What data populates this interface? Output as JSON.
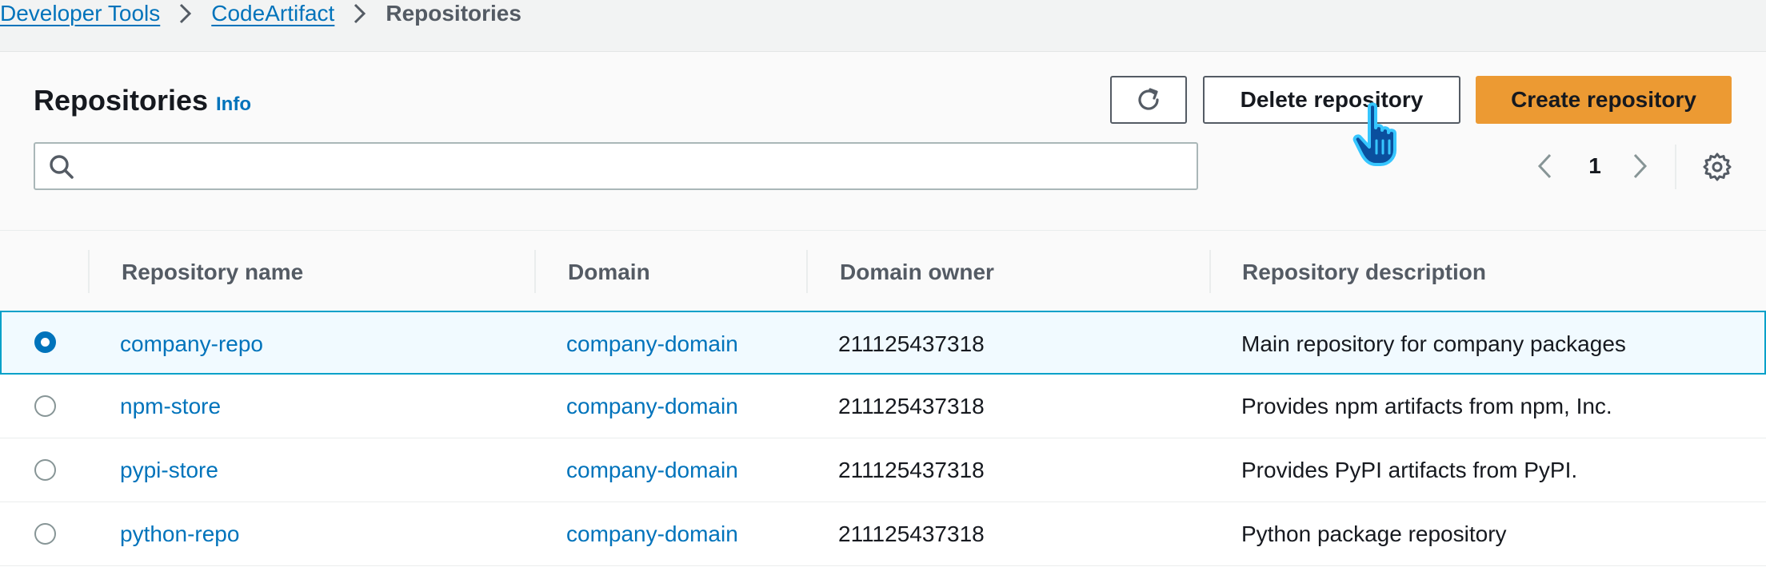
{
  "breadcrumb": {
    "items": [
      "Developer Tools",
      "CodeArtifact"
    ],
    "current": "Repositories"
  },
  "header": {
    "title": "Repositories",
    "info_label": "Info"
  },
  "toolbar": {
    "refresh_icon": "refresh-icon",
    "delete_label": "Delete repository",
    "create_label": "Create repository",
    "create_color": "#ec9a33"
  },
  "search": {
    "placeholder": "",
    "value": ""
  },
  "pagination": {
    "current_page": "1"
  },
  "table": {
    "columns": [
      "Repository name",
      "Domain",
      "Domain owner",
      "Repository description"
    ],
    "rows": [
      {
        "name": "company-repo",
        "domain": "company-domain",
        "owner": "211125437318",
        "description": "Main repository for company packages",
        "selected": true
      },
      {
        "name": "npm-store",
        "domain": "company-domain",
        "owner": "211125437318",
        "description": "Provides npm artifacts from npm, Inc.",
        "selected": false
      },
      {
        "name": "pypi-store",
        "domain": "company-domain",
        "owner": "211125437318",
        "description": "Provides PyPI artifacts from PyPI.",
        "selected": false
      },
      {
        "name": "python-repo",
        "domain": "company-domain",
        "owner": "211125437318",
        "description": "Python package repository",
        "selected": false
      }
    ]
  }
}
